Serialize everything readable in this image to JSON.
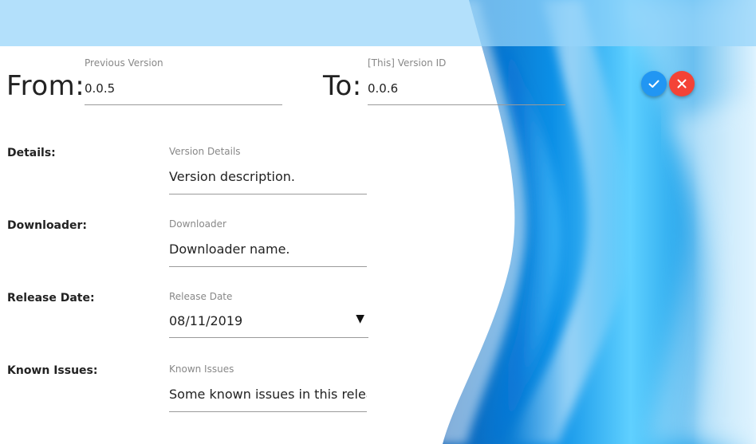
{
  "header": {
    "from_label": "From:",
    "to_label": "To:",
    "previous_version": {
      "label": "Previous Version",
      "value": "0.0.5"
    },
    "version_id": {
      "label": "[This] Version ID",
      "value": "0.0.6"
    }
  },
  "actions": {
    "confirm_icon": "checkmark-icon",
    "cancel_icon": "close-icon",
    "confirm_color": "#2196f3",
    "cancel_color": "#f44336"
  },
  "fields": {
    "details": {
      "row_label": "Details:",
      "float_label": "Version Details",
      "value": "Version description."
    },
    "downloader": {
      "row_label": "Downloader:",
      "float_label": "Downloader",
      "value": "Downloader name."
    },
    "release_date": {
      "row_label": "Release Date:",
      "float_label": "Release Date",
      "value": "08/11/2019"
    },
    "known_issues": {
      "row_label": "Known Issues:",
      "float_label": "Known Issues",
      "value": "Some known issues in this release."
    }
  },
  "colors": {
    "banner": "#96d4fa",
    "accent_blue": "#0a8be0"
  }
}
